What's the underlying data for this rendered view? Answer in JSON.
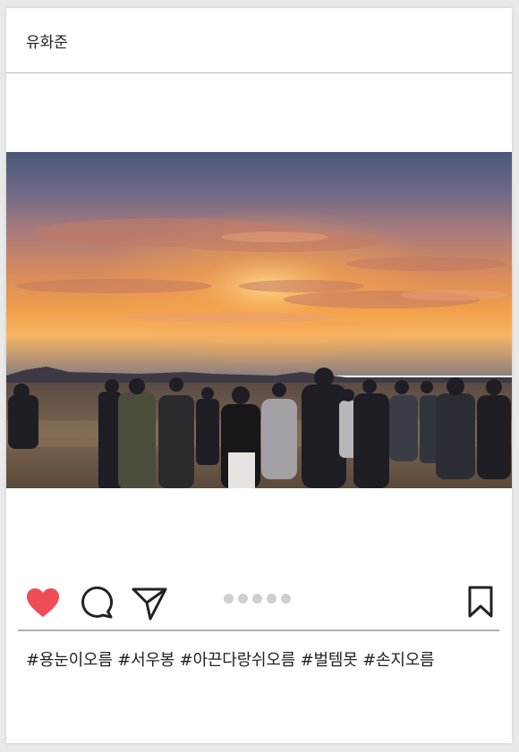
{
  "post": {
    "username": "유화준",
    "caption": "#용눈이오름 #서우봉 #아끈다랑쉬오름 #벌템못 #손지오름",
    "photo_description_icon": "photo",
    "carousel_count": 5,
    "carousel_active_index": 0
  },
  "icons": {
    "like": "heart-icon",
    "comment": "comment-icon",
    "share": "paper-plane-icon",
    "save": "bookmark-icon"
  },
  "colors": {
    "like_active": "#ef4c57",
    "icon_stroke": "#222222",
    "dot": "#cfcfcf"
  }
}
